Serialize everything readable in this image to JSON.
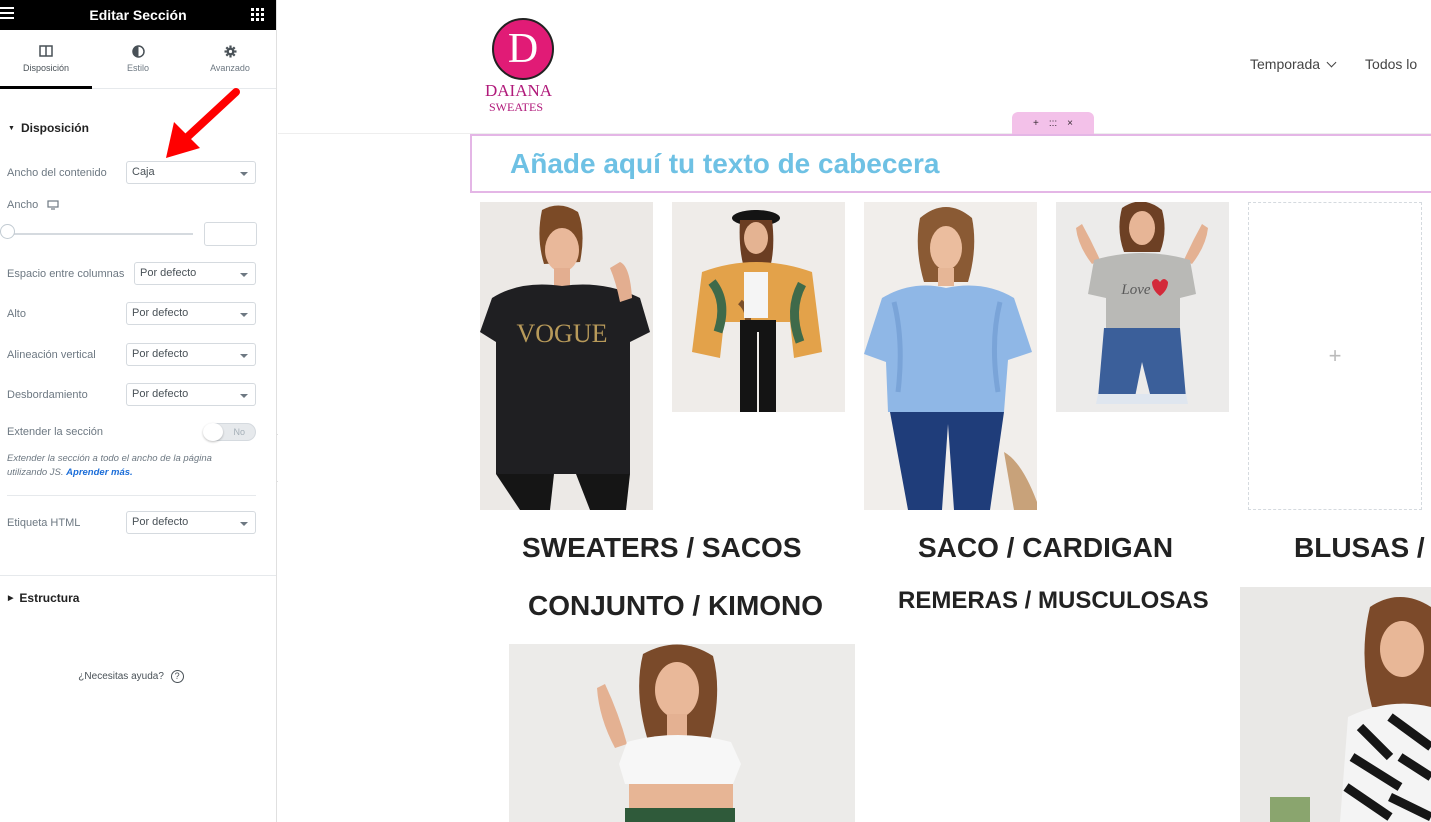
{
  "panel": {
    "title": "Editar Sección",
    "tabs": [
      {
        "label": "Disposición",
        "icon": "columns-icon"
      },
      {
        "label": "Estilo",
        "icon": "half-circle-icon"
      },
      {
        "label": "Avanzado",
        "icon": "gear-icon"
      }
    ],
    "layout_section": {
      "title": "Disposición",
      "content_width": {
        "label": "Ancho del contenido",
        "value": "Caja"
      },
      "width": {
        "label": "Ancho",
        "icon": "desktop-icon",
        "value": ""
      },
      "gap": {
        "label": "Espacio entre columnas",
        "value": "Por defecto"
      },
      "height": {
        "label": "Alto",
        "value": "Por defecto"
      },
      "vertical_align": {
        "label": "Alineación vertical",
        "value": "Por defecto"
      },
      "overflow": {
        "label": "Desbordamiento",
        "value": "Por defecto"
      },
      "stretch": {
        "label": "Extender la sección",
        "value": "No"
      },
      "stretch_desc": "Extender la sección a todo el ancho de la página utilizando JS.",
      "stretch_link": "Aprender más.",
      "html_tag": {
        "label": "Etiqueta HTML",
        "value": "Por defecto"
      }
    },
    "structure_section": {
      "title": "Estructura"
    },
    "help": {
      "label": "¿Necesitas ayuda?"
    }
  },
  "site": {
    "logo": {
      "letter": "D",
      "line1": "DAIANA",
      "line2": "SWEATES"
    },
    "nav": [
      {
        "label": "Temporada",
        "has_dropdown": true
      },
      {
        "label": "Todos lo",
        "has_dropdown": false
      }
    ],
    "section_handle": {
      "add": "+",
      "move": ":::",
      "close": "×"
    },
    "heading": "Añade aquí tu texto de cabecera",
    "empty_column": {
      "add": "+"
    },
    "categories": [
      "SWEATERS / SACOS",
      "SACO / CARDIGAN",
      "BLUSAS /",
      "CONJUNTO / KIMONO",
      "REMERAS / MUSCULOSAS"
    ],
    "photo_texts": {
      "vogue": "VOGUE",
      "love": "Love"
    }
  },
  "colors": {
    "accent_pink": "#e11b76",
    "logo_text": "#b0197a",
    "heading_blue": "#6ec1e4",
    "handle_pink": "#f3c1e9",
    "annotation_red": "#ff0000"
  }
}
